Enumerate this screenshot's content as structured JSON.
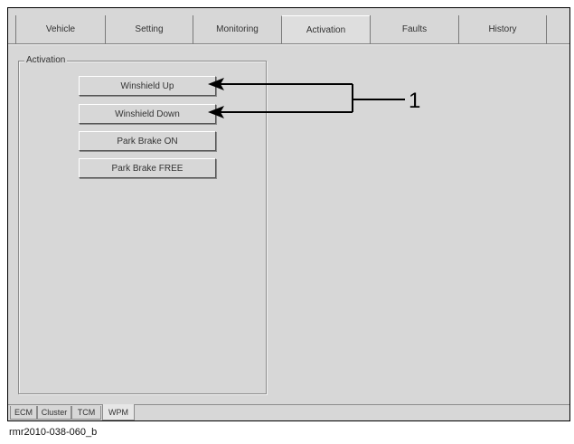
{
  "tabs": [
    {
      "label": "Vehicle",
      "active": false
    },
    {
      "label": "Setting",
      "active": false
    },
    {
      "label": "Monitoring",
      "active": false
    },
    {
      "label": "Activation",
      "active": true
    },
    {
      "label": "Faults",
      "active": false
    },
    {
      "label": "History",
      "active": false
    }
  ],
  "group": {
    "title": "Activation",
    "buttons": [
      {
        "label": "Winshield Up"
      },
      {
        "label": "Winshield Down"
      },
      {
        "label": "Park Brake ON"
      },
      {
        "label": "Park Brake FREE"
      }
    ]
  },
  "bottom_tabs": [
    {
      "label": "ECM",
      "active": false
    },
    {
      "label": "Cluster",
      "active": false
    },
    {
      "label": "TCM",
      "active": false
    },
    {
      "label": "WPM",
      "active": true
    }
  ],
  "callout": {
    "number": "1"
  },
  "caption": "rmr2010-038-060_b"
}
